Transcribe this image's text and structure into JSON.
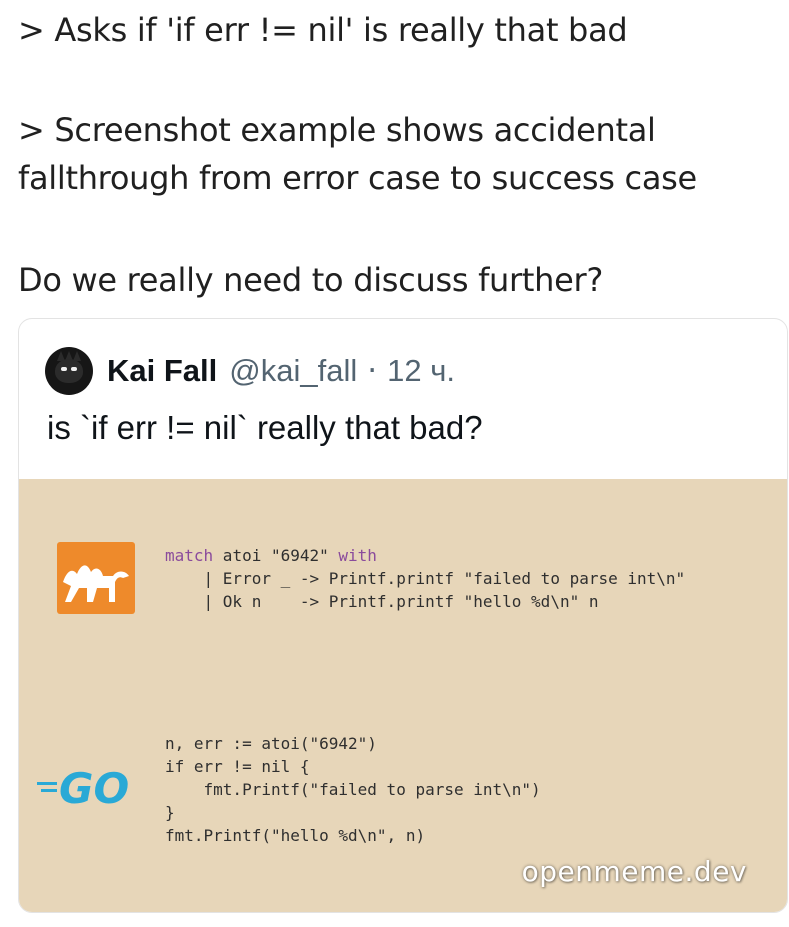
{
  "post": {
    "line1": "> Asks if 'if err != nil' is really that bad",
    "line2": "> Screenshot example shows accidental",
    "line3": "fallthrough from error case to success case",
    "line4": "Do we really need to discuss further?"
  },
  "tweet": {
    "author_name": "Kai Fall",
    "author_handle": "@kai_fall",
    "separator": "·",
    "time": "12 ч.",
    "text": "is `if err != nil` really that bad?"
  },
  "code": {
    "ocaml_line1_kw": "match",
    "ocaml_line1_rest": " atoi \"6942\" ",
    "ocaml_line1_kw2": "with",
    "ocaml_line2": "    | Error _ -> Printf.printf \"failed to parse int\\n\"",
    "ocaml_line3": "    | Ok n    -> Printf.printf \"hello %d\\n\" n",
    "go_line1": "n, err := atoi(\"6942\")",
    "go_line2": "if err != nil {",
    "go_line3": "    fmt.Printf(\"failed to parse int\\n\")",
    "go_line4": "}",
    "go_line5": "fmt.Printf(\"hello %d\\n\", n)"
  },
  "logos": {
    "ocaml_icon": "ocaml-camel-icon",
    "go_icon": "go-logo-icon",
    "go_text": "GO"
  },
  "watermark": "openmeme.dev",
  "colors": {
    "media_bg": "#e7d6b9",
    "ocaml_orange": "#ee8a2b",
    "go_blue": "#29a9d6",
    "handle_gray": "#536471"
  }
}
